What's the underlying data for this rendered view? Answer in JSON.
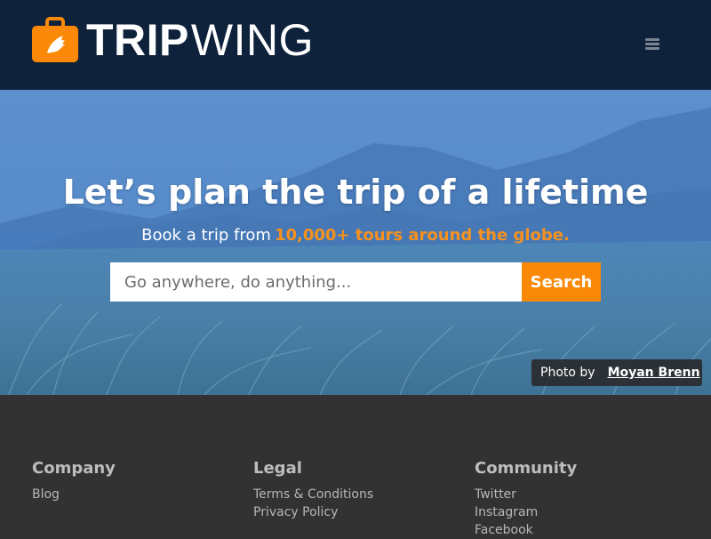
{
  "header": {
    "brand_bold": "TRIP",
    "brand_light": "WING",
    "logo_icon": "suitcase-wing-icon",
    "menu_icon": "hamburger-menu-icon",
    "background": "#0e223b",
    "accent": "#f7911e"
  },
  "hero": {
    "title": "Let’s plan the trip of a lifetime",
    "subtitle_prefix": "Book a trip from",
    "subtitle_highlight": "10,000+ tours around the globe.",
    "search": {
      "placeholder": "Go anywhere, do anything...",
      "value": "",
      "button_label": "Search"
    },
    "credit": {
      "prefix": "Photo by",
      "author": "Moyan Brenn"
    }
  },
  "footer": {
    "columns": [
      {
        "title": "Company",
        "links": [
          "Blog"
        ]
      },
      {
        "title": "Legal",
        "links": [
          "Terms & Conditions",
          "Privacy Policy"
        ]
      },
      {
        "title": "Community",
        "links": [
          "Twitter",
          "Instagram",
          "Facebook"
        ]
      }
    ]
  }
}
